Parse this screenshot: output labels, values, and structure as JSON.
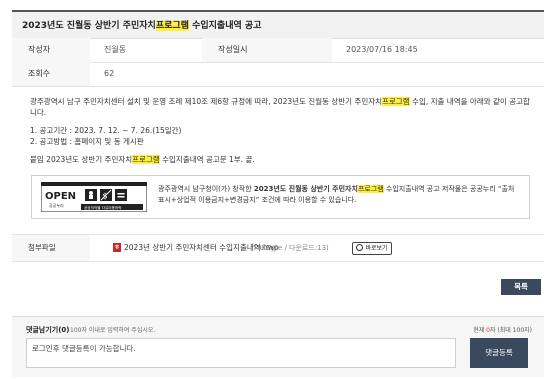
{
  "title": {
    "pre": "2023년도 진월동 상반기 주민자치",
    "highlight": "프로그램",
    "post": " 수입지출내역 공고"
  },
  "info": {
    "author_label": "작성자",
    "author_value": "진월동",
    "date_label": "작성일시",
    "date_value": "2023/07/16 18:45",
    "views_label": "조회수",
    "views_value": "62"
  },
  "body": {
    "para1_pre": "광주광역시 남구 주민자치센터 설치 및 운영 조례 제10조 제6항 규정에 따라, 2023년도 진월동 상반기 주민자치",
    "para1_hl": "프로그램",
    "para1_post": " 수입, 지출 내역을 아래와 같이 공고합니다.",
    "item1": "1. 공고기간 : 2023. 7. 12. ~ 7. 26.(15일간)",
    "item2": "2. 공고방법 : 홈페이지 및 동 게시판",
    "attach_pre": "붙임  2023년도 상반기 주민자치",
    "attach_hl": "프로그램",
    "attach_post": " 수입지출내역 공고문 1부.  끝."
  },
  "license": {
    "badge_open": "OPEN",
    "badge_sub": "공공누리",
    "badge_caption": "공공저작물 자유이용허락",
    "text_pre": "광주광역시 남구청이(가) 창작한 ",
    "text_bold": "2023년도 진월동 상반기 주민자치",
    "text_hl": "프로그램",
    "text_post": " 수입지출내역 공고 저작물은 공공누리 “출처표시+상업적 이용금지+변경금지” 조건에 따라 이용할 수 있습니다."
  },
  "attachment": {
    "label": "첨부파일",
    "file_name": "2023년 상반기 주민자치센터 수입지출내역.hwp",
    "file_meta": "(79KByte / 다운로드:13)",
    "preview_label": "바로보기"
  },
  "list_button": "목록",
  "comment": {
    "header": "댓글남기기(0)",
    "hint": "100자 이내로 입력하여 주십시오.",
    "counter_pre": "현재 ",
    "counter_num": "0",
    "counter_post": "자 (최대 100자)",
    "placeholder": "로그인후 댓글등록이 가능합니다.",
    "submit_label": "댓글등록"
  },
  "colors": {
    "highlight": "#ffef3a",
    "button_dark": "#3a4a5e",
    "file_icon": "#c62828"
  },
  "icons": {
    "file": "hwp-file-icon",
    "preview": "magnifier-icon"
  }
}
